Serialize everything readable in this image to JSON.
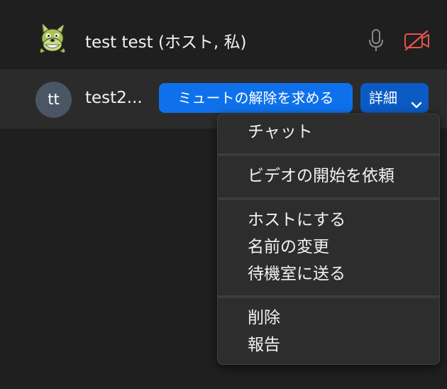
{
  "participants": {
    "host": {
      "name": "test test (ホスト, 私)",
      "avatar_icon": "wolf-avatar-icon",
      "mic_icon": "microphone-icon",
      "video_icon": "video-off-icon",
      "video_icon_color": "#e5544a"
    },
    "guest": {
      "initials": "tt",
      "name": "test2...",
      "unmute_request_label": "ミュートの解除を求める",
      "more_label": "詳細",
      "more_icon": "chevron-down-icon"
    }
  },
  "menu": {
    "chat": "チャット",
    "request_video": "ビデオの開始を依頼",
    "make_host": "ホストにする",
    "rename": "名前の変更",
    "send_to_waiting_room": "待機室に送る",
    "remove": "削除",
    "report": "報告"
  },
  "colors": {
    "background": "#1f1f1f",
    "selected_row": "#2b2b2b",
    "primary_button": "#0e71eb",
    "more_button": "#0b5bc4",
    "menu_background": "#2d2d2d"
  }
}
